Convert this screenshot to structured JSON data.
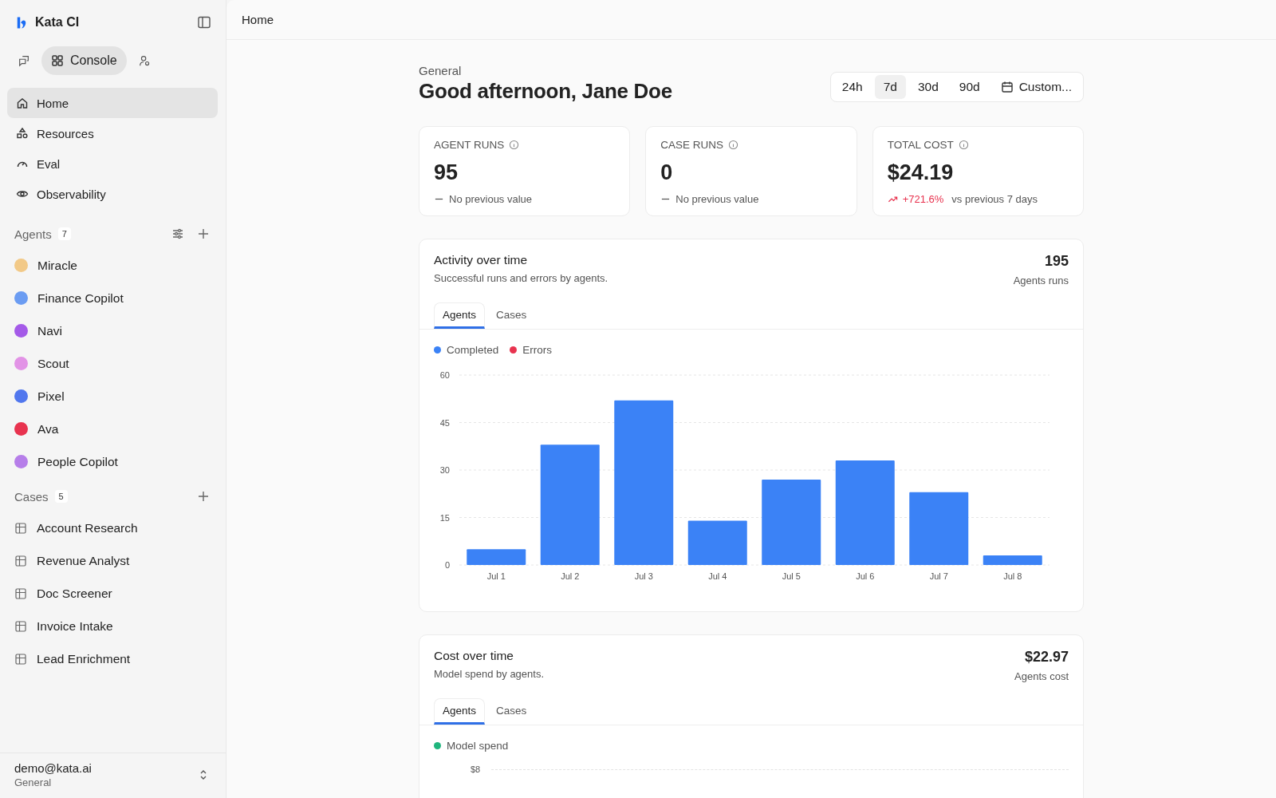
{
  "brand": {
    "name": "Kata CI"
  },
  "mode_switch": [
    {
      "kind": "chat",
      "selected": false
    },
    {
      "label": "Console",
      "kind": "console",
      "selected": true
    },
    {
      "kind": "people",
      "selected": false
    }
  ],
  "nav": [
    {
      "label": "Home",
      "kind": "home",
      "selected": true
    },
    {
      "label": "Resources",
      "kind": "shapes",
      "selected": false
    },
    {
      "label": "Eval",
      "kind": "gauge",
      "selected": false
    },
    {
      "label": "Observability",
      "kind": "eye",
      "selected": false
    }
  ],
  "agents": {
    "title": "Agents",
    "count": "7",
    "items": [
      {
        "name": "Miracle",
        "color": "#f2c987"
      },
      {
        "name": "Finance Copilot",
        "color": "#6b9cf2"
      },
      {
        "name": "Navi",
        "color": "#a45ae8"
      },
      {
        "name": "Scout",
        "color": "#e293e6"
      },
      {
        "name": "Pixel",
        "color": "#5177ee"
      },
      {
        "name": "Ava",
        "color": "#e8334f"
      },
      {
        "name": "People Copilot",
        "color": "#b67ee9"
      }
    ]
  },
  "cases": {
    "title": "Cases",
    "count": "5",
    "items": [
      "Account Research",
      "Revenue Analyst",
      "Doc Screener",
      "Invoice Intake",
      "Lead Enrichment"
    ]
  },
  "account": {
    "email": "demo@kata.ai",
    "workspace": "General"
  },
  "header": {
    "title": "Home"
  },
  "page": {
    "eyebrow": "General",
    "greeting": "Good afternoon, Jane Doe"
  },
  "ranges": [
    {
      "label": "24h",
      "selected": false
    },
    {
      "label": "7d",
      "selected": true
    },
    {
      "label": "30d",
      "selected": false
    },
    {
      "label": "90d",
      "selected": false
    },
    {
      "label": "Custom...",
      "selected": false,
      "kind": "calendar"
    }
  ],
  "metrics": [
    {
      "label": "AGENT RUNS",
      "value": "95",
      "kind": "flat",
      "note": "No previous value"
    },
    {
      "label": "CASE RUNS",
      "value": "0",
      "kind": "flat",
      "note": "No previous value"
    },
    {
      "label": "TOTAL COST",
      "value": "$24.19",
      "kind": "up",
      "change": "+721.6%",
      "note": "vs previous 7 days"
    }
  ],
  "activity": {
    "title": "Activity over time",
    "subtitle": "Successful runs and errors by agents.",
    "total": "195",
    "total_label": "Agents runs",
    "tabs": [
      {
        "label": "Agents",
        "selected": true
      },
      {
        "label": "Cases",
        "selected": false
      }
    ],
    "chart_data": {
      "type": "bar",
      "categories": [
        "Jul 1",
        "Jul 2",
        "Jul 3",
        "Jul 4",
        "Jul 5",
        "Jul 6",
        "Jul 7",
        "Jul 8"
      ],
      "series": [
        {
          "name": "Completed",
          "color": "#3b82f6",
          "values": [
            5,
            38,
            52,
            14,
            27,
            33,
            23,
            3
          ]
        },
        {
          "name": "Errors",
          "color": "#e8334f",
          "values": [
            0,
            0,
            0,
            0,
            0,
            0,
            0,
            0
          ]
        }
      ],
      "grid": true,
      "ylim": [
        0,
        60
      ],
      "yticks": [
        0,
        15,
        30,
        45,
        60
      ]
    }
  },
  "cost": {
    "title": "Cost over time",
    "subtitle": "Model spend by agents.",
    "total": "$22.97",
    "total_label": "Agents cost",
    "tabs": [
      {
        "label": "Agents",
        "selected": true
      },
      {
        "label": "Cases",
        "selected": false
      }
    ],
    "legend": [
      {
        "name": "Model spend",
        "color": "#1fb57d"
      }
    ],
    "top_tick": "$8"
  }
}
